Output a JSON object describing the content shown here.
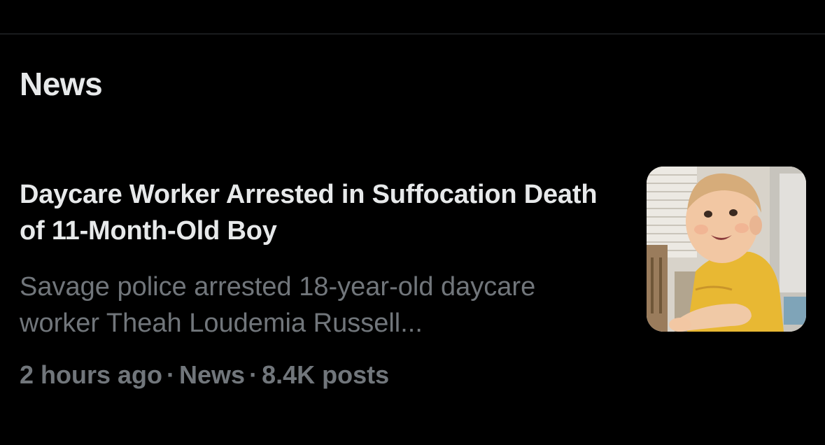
{
  "section": {
    "title": "News"
  },
  "article": {
    "headline": "Daycare Worker Arrested in Suffocation Death of 11-Month-Old Boy",
    "summary": "Savage police arrested 18-year-old daycare worker Theah Loudemia Russell...",
    "time": "2 hours ago",
    "category": "News",
    "posts": "8.4K posts",
    "separator": "·",
    "thumbnail_icon": "news-photo-thumbnail"
  },
  "colors": {
    "background": "#000000",
    "primary_text": "#e7e9ea",
    "secondary_text": "#71767b",
    "divider": "#2f3336"
  }
}
